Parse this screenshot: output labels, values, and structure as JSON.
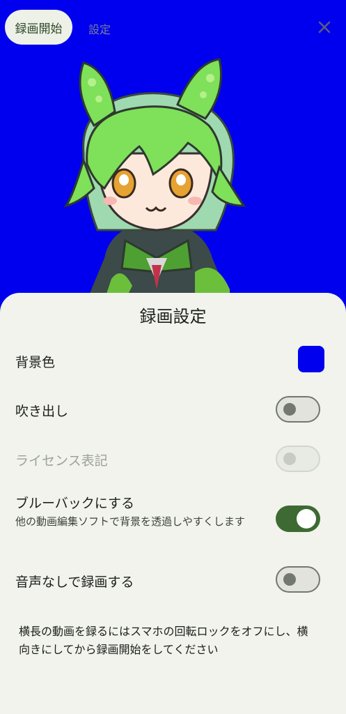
{
  "header": {
    "record_button": "録画開始",
    "settings_tab": "設定",
    "close_icon": "close-icon"
  },
  "colors": {
    "background": "#0000ee",
    "accent": "#3d6a33",
    "sheet": "#f1f3ec"
  },
  "sheet": {
    "title": "録画設定",
    "settings": {
      "background_color": {
        "label": "背景色",
        "value": "#0000ee"
      },
      "speech_bubble": {
        "label": "吹き出し",
        "enabled": false
      },
      "license": {
        "label": "ライセンス表記",
        "enabled": false,
        "disabled": true
      },
      "blueback": {
        "label": "ブルーバックにする",
        "description": "他の動画編集ソフトで背景を透過しやすくします",
        "enabled": true
      },
      "no_audio": {
        "label": "音声なしで録画する",
        "enabled": false
      }
    },
    "note": "横長の動画を録るにはスマホの回転ロックをオフにし、横向きにしてから録画開始をしてください"
  }
}
